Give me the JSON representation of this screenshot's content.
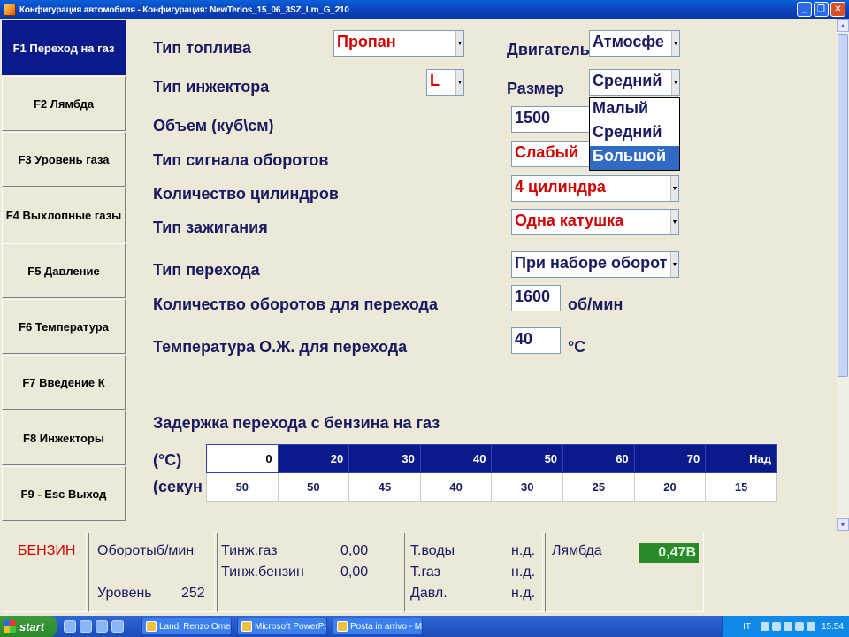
{
  "window": {
    "title": "Конфигурация автомобиля - Конфигурация: NewTerios_15_06_3SZ_Lm_G_210",
    "buttons": {
      "minimize": "_",
      "restore": "❐",
      "close": "✕"
    }
  },
  "sidebar": {
    "items": [
      {
        "label": "F1 Переход на газ",
        "active": true
      },
      {
        "label": "F2 Лямбда"
      },
      {
        "label": "F3 Уровень газа"
      },
      {
        "label": "F4 Выхлопные газы"
      },
      {
        "label": "F5 Давление"
      },
      {
        "label": "F6 Температура"
      },
      {
        "label": "F7 Введение К"
      },
      {
        "label": "F8 Инжекторы"
      },
      {
        "label": "F9 - Esc Выход"
      }
    ]
  },
  "form": {
    "fuel_type": {
      "label": "Тип топлива",
      "value": "Пропан"
    },
    "injector_type": {
      "label": "Тип инжектора",
      "value": "L"
    },
    "engine": {
      "label": "Двигатель",
      "value": "Атмосфе"
    },
    "size": {
      "label": "Размер",
      "value": "Средний",
      "options": [
        "Малый",
        "Средний",
        "Большой"
      ],
      "highlighted": "Большой"
    },
    "volume": {
      "label": "Объем (куб\\см)",
      "value": "1500"
    },
    "rpm_signal": {
      "label": "Тип сигнала оборотов",
      "value": "Слабый"
    },
    "cylinders": {
      "label": "Количество цилиндров",
      "value": "4 цилиндра"
    },
    "ignition": {
      "label": "Тип зажигания",
      "value": "Одна катушка"
    },
    "switch_type": {
      "label": "Тип перехода",
      "value": "При наборе оборот"
    },
    "switch_rpm": {
      "label": "Количество оборотов для перехода",
      "value": "1600",
      "unit": "об/мин"
    },
    "switch_temp": {
      "label": "Температура О.Ж. для перехода",
      "value": "40",
      "unit": "°C"
    }
  },
  "delay": {
    "title": "Задержка перехода с бензина на газ",
    "row1_label": "(°C)",
    "row2_label": "(секун",
    "temps": [
      "0",
      "20",
      "30",
      "40",
      "50",
      "60",
      "70",
      "Над"
    ],
    "seconds": [
      "50",
      "50",
      "45",
      "40",
      "30",
      "25",
      "20",
      "15"
    ]
  },
  "status": {
    "fuel": "БЕНЗИН",
    "rpm_label": "Оборотыб/мин",
    "level_label": "Уровень",
    "level_value": "252",
    "tinj_gas_label": "Тинж.газ",
    "tinj_gas_value": "0,00",
    "tinj_petrol_label": "Тинж.бензин",
    "tinj_petrol_value": "0,00",
    "t_water_label": "Т.воды",
    "t_water_value": "н.д.",
    "t_gas_label": "Т.газ",
    "t_gas_value": "н.д.",
    "pressure_label": "Давл.",
    "pressure_value": "н.д.",
    "lambda_label": "Лямбда",
    "lambda_value": "0,47В"
  },
  "taskbar": {
    "start": "start",
    "tasks": [
      "Landi Renzo Omegas",
      "Microsoft PowerPoint ...",
      "Posta in arrivo - Micro..."
    ],
    "lang": "IT",
    "clock": "15.54"
  }
}
